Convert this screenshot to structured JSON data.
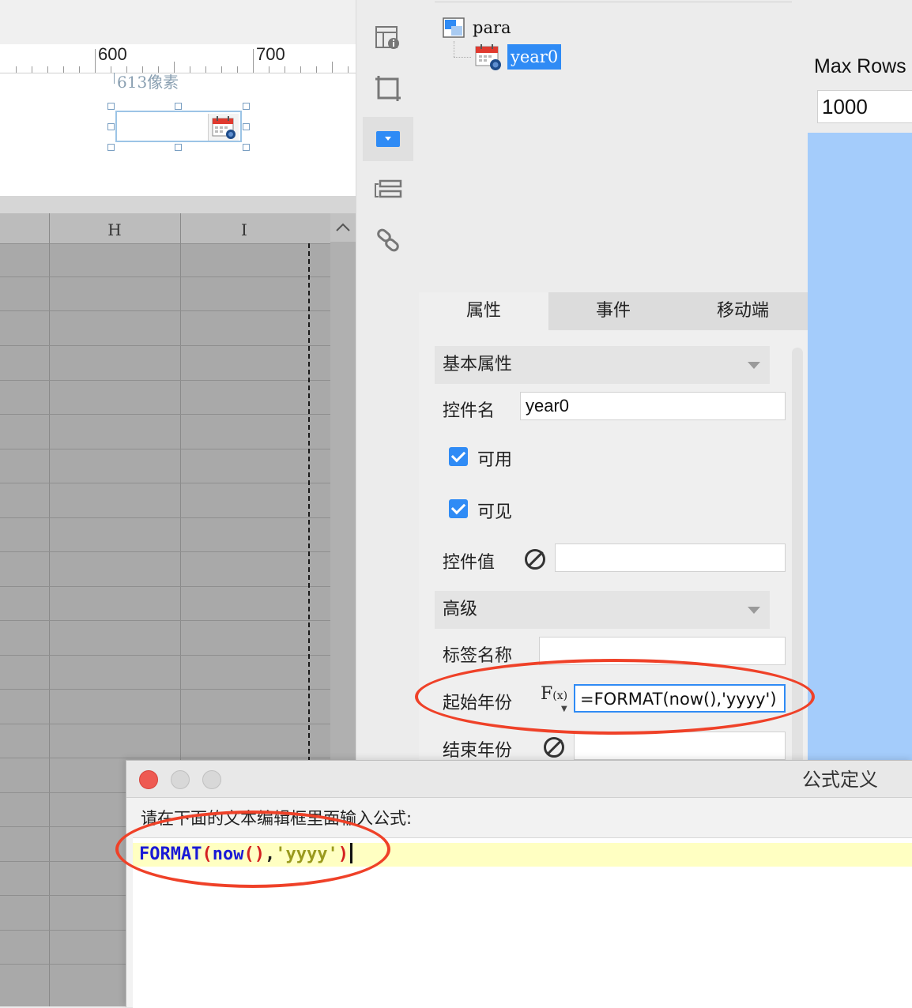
{
  "ruler": {
    "marks": [
      "600",
      "700"
    ],
    "pixel_label": "613像素"
  },
  "grid": {
    "columns": [
      "H",
      "I"
    ]
  },
  "toolbar": {
    "icons": [
      "widget-settings-icon",
      "frame-icon",
      "dropdown-widget-icon",
      "layout-icon",
      "link-icon"
    ]
  },
  "tree": {
    "root": "para",
    "child": "year0"
  },
  "tabs": [
    "属性",
    "事件",
    "移动端"
  ],
  "props": {
    "basic_section": "基本属性",
    "widget_name_label": "控件名",
    "widget_name_value": "year0",
    "enabled_label": "可用",
    "visible_label": "可见",
    "widget_value_label": "控件值",
    "advanced_section": "高级",
    "tag_name_label": "标签名称",
    "start_year_label": "起始年份",
    "start_year_value": "=FORMAT(now(),'yyyy')",
    "end_year_label": "结束年份"
  },
  "right_panel": {
    "max_rows_label": "Max Rows",
    "max_rows_value": "1000"
  },
  "dialog": {
    "title": "公式定义",
    "instruction": "请在下面的文本编辑框里面输入公式:",
    "code": {
      "fn": "FORMAT",
      "p1": "(",
      "fn2": "now",
      "p2": "()",
      "comma": ",",
      "str": "'yyyy'",
      "p3": ")"
    }
  },
  "colors": {
    "accent": "#2f8bf5",
    "annotation": "#ef4128",
    "selection_blue": "#a4ccfb"
  }
}
